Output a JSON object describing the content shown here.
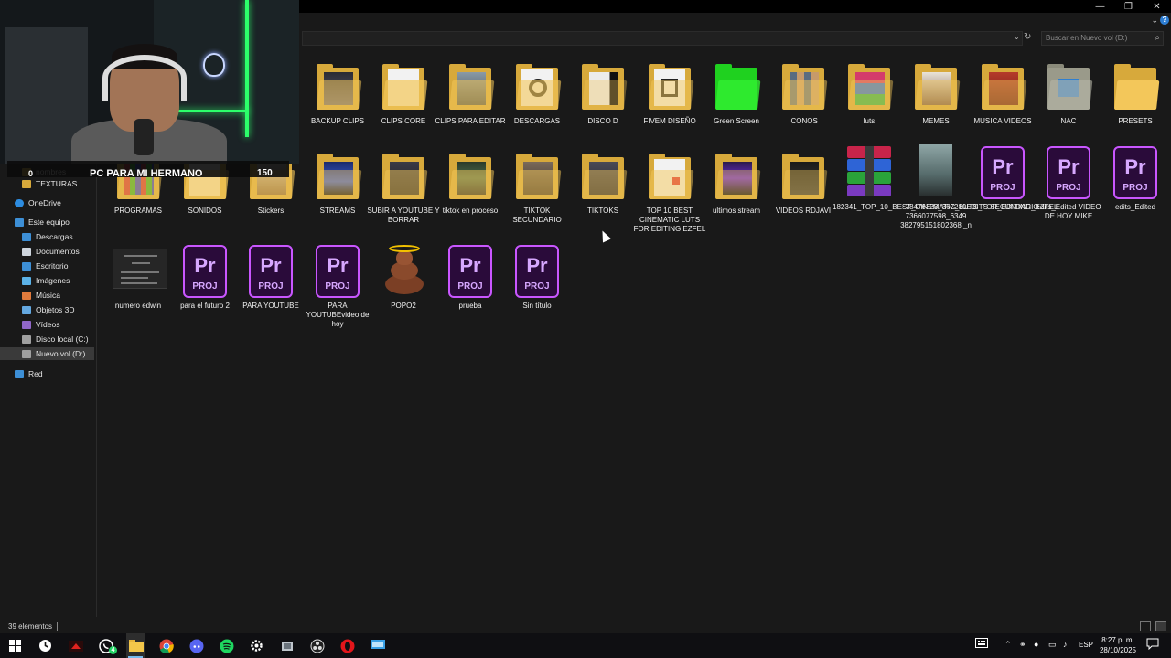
{
  "window": {
    "minimize": "—",
    "restore": "❐",
    "close": "✕",
    "ribbon_toggle": "⌄",
    "help": "?"
  },
  "addressbar": {
    "dropdown": "⌄",
    "refresh": "↻",
    "search_placeholder": "Buscar en Nuevo vol (D:)",
    "search_icon": "⌕"
  },
  "webcam": {
    "banner_text": "PC PARA MI HERMANO",
    "count_left": "0",
    "count_right": "150",
    "neon_color": "#2cff6a"
  },
  "sidebar": {
    "partial_above": [
      "nombres",
      "TEXTURAS"
    ],
    "items": [
      {
        "label": "OneDrive",
        "icon": "cloud-icon",
        "color": "#2d8ce0"
      },
      {
        "label": "Este equipo",
        "icon": "computer-icon",
        "color": "#3d8fd6"
      },
      {
        "label": "Descargas",
        "icon": "download-icon",
        "color": "#3d8fd6"
      },
      {
        "label": "Documentos",
        "icon": "document-icon",
        "color": "#cfd6de"
      },
      {
        "label": "Escritorio",
        "icon": "desktop-icon",
        "color": "#3d8fd6"
      },
      {
        "label": "Imágenes",
        "icon": "pictures-icon",
        "color": "#5bb2e8"
      },
      {
        "label": "Música",
        "icon": "music-icon",
        "color": "#e07a3c"
      },
      {
        "label": "Objetos 3D",
        "icon": "objects-3d-icon",
        "color": "#64a8e0"
      },
      {
        "label": "Vídeos",
        "icon": "videos-icon",
        "color": "#9167c9"
      },
      {
        "label": "Disco local (C:)",
        "icon": "drive-c-icon",
        "color": "#a0a0a0"
      },
      {
        "label": "Nuevo vol (D:)",
        "icon": "drive-d-icon",
        "color": "#a0a0a0"
      },
      {
        "label": "Red",
        "icon": "network-icon",
        "color": "#3d8fd6"
      }
    ],
    "selected": "Nuevo vol (D:)"
  },
  "files": {
    "row1": [
      {
        "name": "BACKUP CLIPS",
        "type": "folder"
      },
      {
        "name": "CLIPS CORE",
        "type": "folder"
      },
      {
        "name": "CLIPS PARA EDITAR",
        "type": "folder"
      },
      {
        "name": "DESCARGAS",
        "type": "folder"
      },
      {
        "name": "DISCO D",
        "type": "folder"
      },
      {
        "name": "FIVEM DISEÑO",
        "type": "folder"
      },
      {
        "name": "Green Screen",
        "type": "folder"
      },
      {
        "name": "ICONOS",
        "type": "folder"
      },
      {
        "name": "luts",
        "type": "folder"
      },
      {
        "name": "MEMES",
        "type": "folder"
      },
      {
        "name": "MUSICA VIDEOS",
        "type": "folder"
      },
      {
        "name": "NAC",
        "type": "folder"
      },
      {
        "name": "PRESETS",
        "type": "folder"
      }
    ],
    "row2": [
      {
        "name": "PROGRAMAS",
        "type": "folder"
      },
      {
        "name": "SONIDOS",
        "type": "folder"
      },
      {
        "name": "Stickers",
        "type": "folder"
      },
      {
        "name": "STREAMS",
        "type": "folder"
      },
      {
        "name": "SUBIR A YOUTUBE Y BORRAR",
        "type": "folder"
      },
      {
        "name": "tiktok en proceso",
        "type": "folder"
      },
      {
        "name": "TIKTOK SECUNDARIO",
        "type": "folder"
      },
      {
        "name": "TIKTOKS",
        "type": "folder"
      },
      {
        "name": "TOP 10 BEST CINEMATIC LUTS FOR EDITING EZFEL",
        "type": "folder"
      },
      {
        "name": "ultimos stream",
        "type": "folder"
      },
      {
        "name": "VIDEOS RDJAVI",
        "type": "folder"
      },
      {
        "name": "182341_TOP_10_BEST_CINEMATIC_LUTS_FOR_EDITING_EZFEL",
        "type": "winrar"
      },
      {
        "name": "78476323_367280 7366077598_6349 382795151802368 _n",
        "type": "image"
      },
      {
        "name": "EDITS SECUNDARIO",
        "type": "premiere"
      },
      {
        "name": "edits_Edited VIDEO DE HOY MIKE",
        "type": "premiere"
      },
      {
        "name": "edits_Edited",
        "type": "premiere"
      }
    ],
    "row3": [
      {
        "name": "numero edwin",
        "type": "document"
      },
      {
        "name": "para el futuro 2",
        "type": "premiere"
      },
      {
        "name": "PARA YOUTUBE",
        "type": "premiere"
      },
      {
        "name": "PARA YOUTUBEvideo de hoy",
        "type": "premiere"
      },
      {
        "name": "POPO2",
        "type": "poop"
      },
      {
        "name": "prueba",
        "type": "premiere"
      },
      {
        "name": "Sin título",
        "type": "premiere"
      }
    ],
    "premiere_glyph": "Pr",
    "premiere_ext": "PROJ",
    "premiere_color": "#c956ff"
  },
  "status": {
    "item_count": "39 elementos"
  },
  "taskbar": {
    "apps": [
      "windows-start-icon",
      "clock-app-icon",
      "amd-icon",
      "whatsapp-icon",
      "file-explorer-icon",
      "chrome-icon",
      "discord-icon",
      "spotify-icon",
      "settings-icon",
      "game-icon",
      "obs-icon",
      "opera-icon",
      "remote-desktop-icon"
    ],
    "whatsapp_badge": "4",
    "language": "ESP",
    "time": "8:27 p. m.",
    "date": "28/10/2025"
  }
}
